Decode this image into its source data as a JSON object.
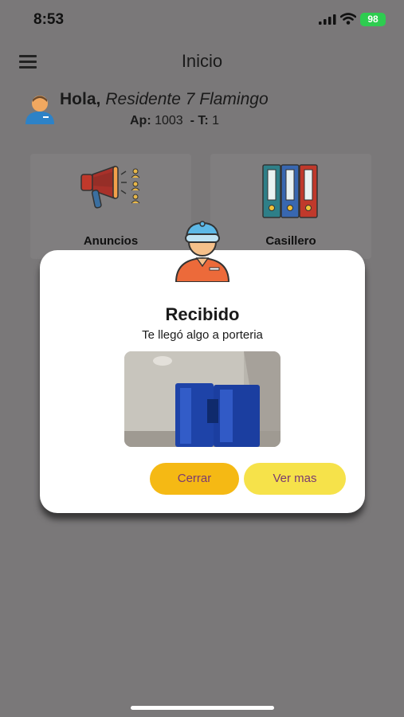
{
  "status_bar": {
    "time": "8:53",
    "battery": "98"
  },
  "header": {
    "title": "Inicio"
  },
  "profile": {
    "greeting": "Hola,",
    "name": "Residente 7 Flamingo",
    "ap_label": "Ap:",
    "ap_value": "1003",
    "t_label": "- T:",
    "t_value": "1"
  },
  "cards": [
    {
      "label": "Anuncios",
      "icon": "megaphone-icon"
    },
    {
      "label": "Casillero",
      "icon": "binders-icon"
    }
  ],
  "dialog": {
    "title": "Recibido",
    "subtitle": "Te llegó algo a porteria",
    "close_label": "Cerrar",
    "more_label": "Ver mas",
    "colors": {
      "close_button": "#f5b914",
      "more_button": "#f6e24a",
      "button_text": "#7a3a70"
    }
  }
}
